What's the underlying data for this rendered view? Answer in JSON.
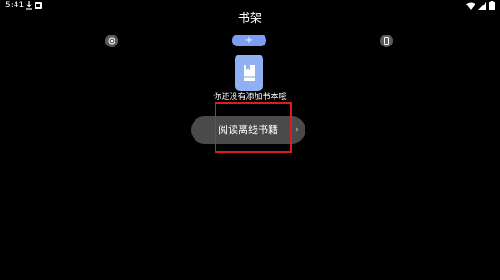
{
  "status_bar": {
    "time": "5:41",
    "icons": [
      "download-icon",
      "app-notification-icon",
      "wifi-icon",
      "signal-icon",
      "battery-icon"
    ]
  },
  "header": {
    "title": "书架"
  },
  "toolbar": {
    "left_icon": "settings-circle-icon",
    "add_label": "+",
    "right_icon": "phone-icon",
    "accent_color": "#7b9ef2"
  },
  "empty_state": {
    "icon": "book-icon",
    "message": "你还没有添加书本哦"
  },
  "offline_button": {
    "label": "阅读离线书籍",
    "arrow": "›"
  },
  "annotation": {
    "highlight_color": "#d81e1e"
  }
}
